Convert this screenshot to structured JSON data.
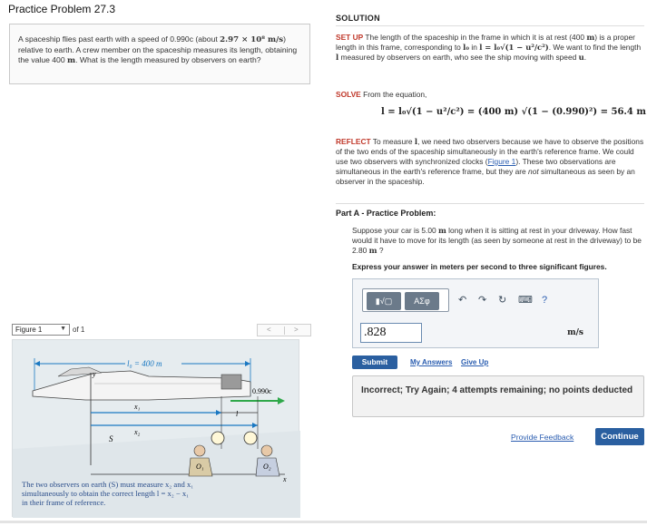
{
  "page": {
    "title": "Practice Problem 27.3"
  },
  "problem": {
    "text_1": "A spaceship flies past earth with a speed of 0.990c (about ",
    "speed_value": "2.97 × 10⁸ m/s",
    "text_2": ") relative to earth. A crew member on the spaceship measures its length, obtaining the value 400 ",
    "unit_m": "m",
    "text_3": ". What is the length measured by observers on earth?"
  },
  "figure": {
    "select_label": "Figure 1",
    "of_label": "of 1",
    "prev": "<",
    "next": ">",
    "label_l0": "l₀ = 400 m",
    "label_speed": "0.990c",
    "label_x1": "x₁",
    "label_x2": "x₂",
    "label_l": "l",
    "label_S": "S",
    "label_O1": "O₁",
    "label_O2": "O₂",
    "label_x": "x",
    "label_y": "y",
    "caption_1": "The two observers on earth (S) must measure x₂ and x₁",
    "caption_2": "simultaneously to obtain the correct length l = x₂ − x₁",
    "caption_3": "in their frame of reference."
  },
  "solution": {
    "heading": "SOLUTION",
    "setup_tag": "SET UP",
    "setup_text_1": " The length of the spaceship in the frame in which it is at rest (400 ",
    "setup_m": "m",
    "setup_text_2": ") is a proper length in this frame, corresponding to ",
    "setup_l0": "l₀",
    "setup_text_3": " in ",
    "setup_formula": "l = l₀√(1 − u²/c²)",
    "setup_text_4": ". We want to find the length ",
    "setup_l": "l",
    "setup_text_5": " measured by observers on earth, who see the ship moving with speed ",
    "setup_u": "u",
    "setup_text_6": ".",
    "solve_tag": "SOLVE",
    "solve_text": " From the equation,",
    "equation": "l = l₀√(1 − u²/c²) = (400 m) √(1 − (0.990)²) = 56.4 m",
    "reflect_tag": "REFLECT",
    "reflect_text_1": " To measure ",
    "reflect_l": "l",
    "reflect_text_2": ", we need two observers because we have to observe the positions of the two ends of the spaceship simultaneously in the earth's reference frame. We could use two observers with synchronized clocks (",
    "reflect_link": "Figure 1",
    "reflect_text_3": "). These two observations are simultaneous in the earth's reference frame, but they are ",
    "reflect_not": "not",
    "reflect_text_4": " simultaneous as seen by an observer in the spaceship."
  },
  "part_a": {
    "title": "Part A - Practice Problem:",
    "text_1": "Suppose your car is 5.00 ",
    "m1": "m",
    "text_2": " long when it is sitting at rest in your driveway. How fast would it have to move for its length (as seen by someone at rest in the driveway) to be 2.80 ",
    "m2": "m",
    "text_3": " ?",
    "instruction": "Express your answer in meters per second to three significant figures.",
    "toolbar": {
      "template_label": "▮√▢",
      "symbols_label": "ΑΣφ",
      "undo": "↶",
      "redo": "↷",
      "reset": "↻",
      "keyboard": "⌨",
      "help": "?"
    },
    "answer_value": ".828",
    "unit": "m/s",
    "submit_label": "Submit",
    "my_answers_label": "My Answers",
    "give_up_label": "Give Up",
    "feedback": "Incorrect; Try Again; 4 attempts remaining; no points deducted",
    "provide_feedback_label": "Provide Feedback",
    "continue_label": "Continue"
  }
}
